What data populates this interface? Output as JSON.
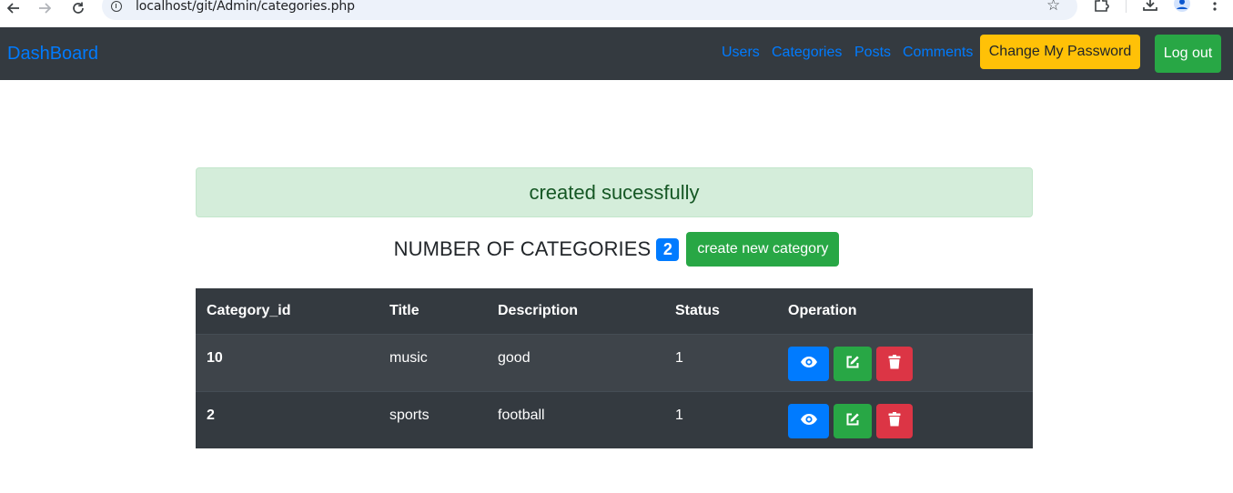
{
  "browser": {
    "url": "localhost/git/Admin/categories.php"
  },
  "navbar": {
    "brand": "DashBoard",
    "links": [
      "Users",
      "Categories",
      "Posts",
      "Comments"
    ],
    "change_password_label": "Change My Password",
    "logout_label": "Log out"
  },
  "alert": {
    "message": "created sucessfully"
  },
  "summary": {
    "heading": "NUMBER OF CATEGORIES",
    "count": "2",
    "create_label": "create new category"
  },
  "table": {
    "headers": [
      "Category_id",
      "Title",
      "Description",
      "Status",
      "Operation"
    ],
    "rows": [
      {
        "id": "10",
        "title": "music",
        "description": "good",
        "status": "1"
      },
      {
        "id": "2",
        "title": "sports",
        "description": "football",
        "status": "1"
      }
    ]
  },
  "icons": {
    "view": "eye-icon",
    "edit": "edit-icon",
    "delete": "trash-icon"
  },
  "colors": {
    "primary": "#007bff",
    "success": "#28a745",
    "danger": "#dc3545",
    "warning": "#ffc107",
    "dark": "#343a40"
  }
}
